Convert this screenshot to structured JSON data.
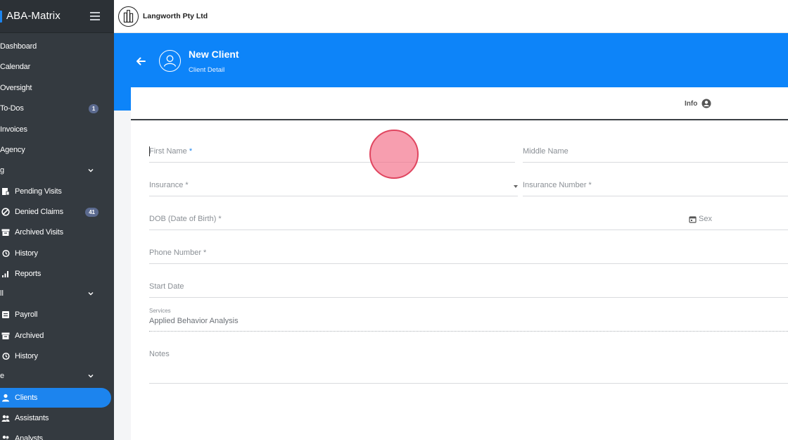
{
  "sidebar": {
    "brand": "ABA-Matrix",
    "items": [
      {
        "label": "Dashboard"
      },
      {
        "label": "Calendar"
      },
      {
        "label": "Oversight"
      },
      {
        "label": "To-Dos",
        "badge": "1"
      },
      {
        "label": "Invoices"
      },
      {
        "label": "Agency"
      }
    ],
    "group1": {
      "label": "g",
      "items": [
        {
          "label": "Pending Visits",
          "icon": "document-icon"
        },
        {
          "label": "Denied Claims",
          "icon": "ban-icon",
          "badge": "41"
        },
        {
          "label": "Archived Visits",
          "icon": "archive-icon"
        },
        {
          "label": "History",
          "icon": "history-icon"
        },
        {
          "label": "Reports",
          "icon": "chart-icon"
        }
      ]
    },
    "group2": {
      "label": "ll",
      "items": [
        {
          "label": "Payroll",
          "icon": "payroll-icon"
        },
        {
          "label": "Archived",
          "icon": "archive-icon"
        },
        {
          "label": "History",
          "icon": "history-icon"
        }
      ]
    },
    "group3": {
      "label": "e",
      "items": [
        {
          "label": "Clients",
          "icon": "user-icon"
        },
        {
          "label": "Assistants",
          "icon": "users-icon"
        },
        {
          "label": "Analysts",
          "icon": "users-icon"
        }
      ]
    }
  },
  "topbar": {
    "company_name": "Langworth Pty Ltd"
  },
  "header": {
    "title": "New Client",
    "subtitle": "Client Detail"
  },
  "tabs": {
    "info": "Info"
  },
  "form": {
    "first_name": "First Name",
    "required_mark": "*",
    "middle_name": "Middle Name",
    "insurance": "Insurance *",
    "insurance_number": "Insurance Number *",
    "dob": "DOB (Date of Birth) *",
    "sex": "Sex",
    "phone": "Phone Number *",
    "start_date": "Start Date",
    "services_label": "Services",
    "services_value": "Applied Behavior Analysis",
    "notes": "Notes"
  },
  "colors": {
    "accent": "#0d84f9",
    "sidebar": "#343a40",
    "badge": "#5b6a8f",
    "required": "#1c84ee"
  }
}
